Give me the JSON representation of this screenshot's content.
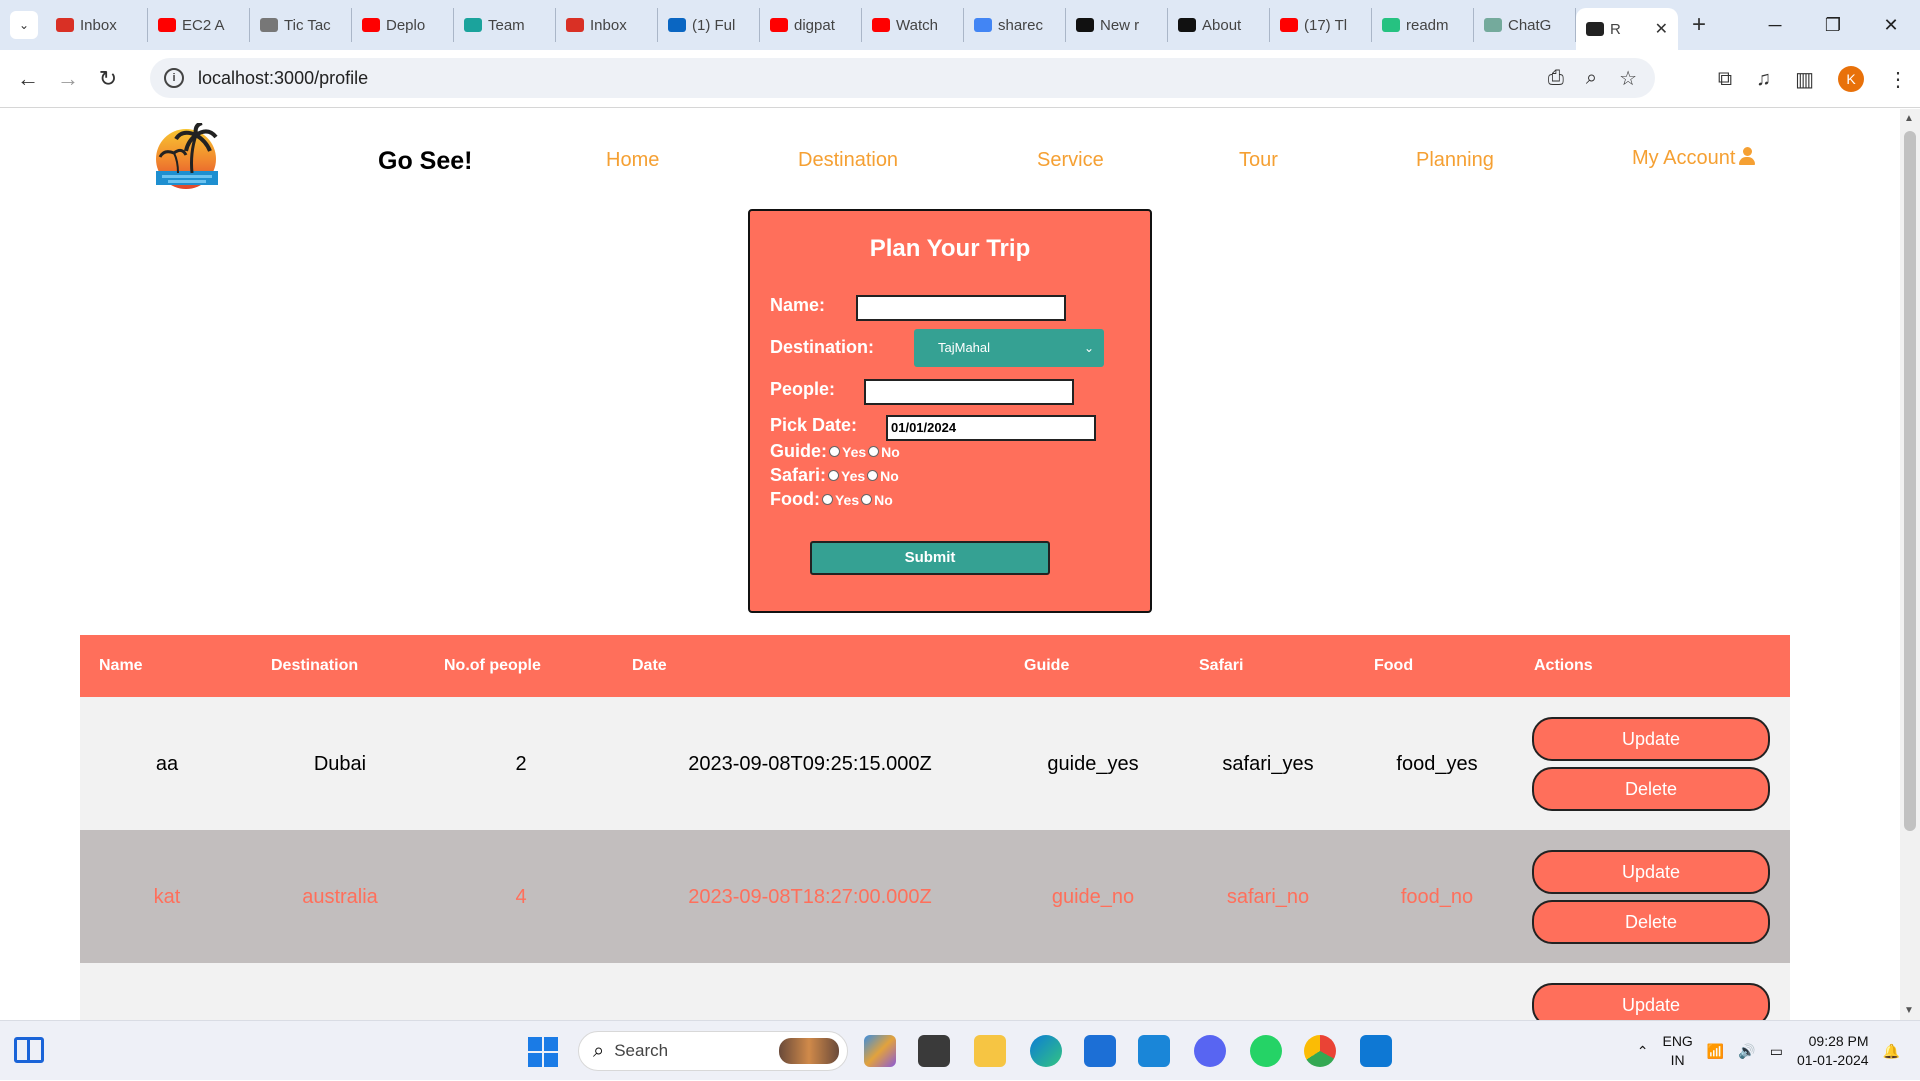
{
  "browser": {
    "tabs": [
      {
        "label": "Inbox",
        "icon": "gmail-icon",
        "color": "#d93025"
      },
      {
        "label": "EC2 A",
        "icon": "youtube-icon",
        "color": "#ff0000"
      },
      {
        "label": "Tic Tac",
        "icon": "globe-icon",
        "color": "#777777"
      },
      {
        "label": "Deplo",
        "icon": "youtube-icon",
        "color": "#ff0000"
      },
      {
        "label": "Team",
        "icon": "diamond-icon",
        "color": "#1ba39c"
      },
      {
        "label": "Inbox",
        "icon": "gmail-icon",
        "color": "#d93025"
      },
      {
        "label": "(1) Ful",
        "icon": "linkedin-icon",
        "color": "#0a66c2"
      },
      {
        "label": "digpat",
        "icon": "youtube-icon",
        "color": "#ff0000"
      },
      {
        "label": "Watch",
        "icon": "youtube-icon",
        "color": "#ff0000"
      },
      {
        "label": "sharec",
        "icon": "google-icon",
        "color": "#4285f4"
      },
      {
        "label": "New r",
        "icon": "github-icon",
        "color": "#111111"
      },
      {
        "label": "About",
        "icon": "github-icon",
        "color": "#111111"
      },
      {
        "label": "(17) Tl",
        "icon": "youtube-icon",
        "color": "#ff0000"
      },
      {
        "label": "readm",
        "icon": "replit-icon",
        "color": "#26c281"
      },
      {
        "label": "ChatG",
        "icon": "chatgpt-icon",
        "color": "#74aa9c"
      },
      {
        "label": "R",
        "icon": "react-icon",
        "color": "#222222",
        "active": true
      }
    ],
    "url": "localhost:3000/profile",
    "profile_initial": "K"
  },
  "header": {
    "brand": "Go See!",
    "nav": [
      "Home",
      "Destination",
      "Service",
      "Tour",
      "Planning",
      "My Account"
    ]
  },
  "form": {
    "title": "Plan Your Trip",
    "name_label": "Name:",
    "name_value": "",
    "destination_label": "Destination:",
    "destination_value": "TajMahal",
    "people_label": "People:",
    "people_value": "",
    "date_label": "Pick Date:",
    "date_value": "01/01/2024",
    "guide_label": "Guide:",
    "safari_label": "Safari:",
    "food_label": "Food:",
    "yes": "Yes",
    "no": "No",
    "submit": "Submit"
  },
  "table": {
    "headers": [
      "Name",
      "Destination",
      "No.of people",
      "Date",
      "Guide",
      "Safari",
      "Food",
      "Actions"
    ],
    "rows": [
      {
        "name": "aa",
        "destination": "Dubai",
        "people": "2",
        "date": "2023-09-08T09:25:15.000Z",
        "guide": "guide_yes",
        "safari": "safari_yes",
        "food": "food_yes"
      },
      {
        "name": "kat",
        "destination": "australia",
        "people": "4",
        "date": "2023-09-08T18:27:00.000Z",
        "guide": "guide_no",
        "safari": "safari_no",
        "food": "food_no"
      }
    ],
    "update_label": "Update",
    "delete_label": "Delete"
  },
  "taskbar": {
    "search_placeholder": "Search",
    "lang": "ENG",
    "region": "IN",
    "time": "09:28 PM",
    "date": "01-01-2024"
  },
  "colors": {
    "accent": "#ff6f5b",
    "teal": "#35a193",
    "nav": "#f5a033"
  }
}
